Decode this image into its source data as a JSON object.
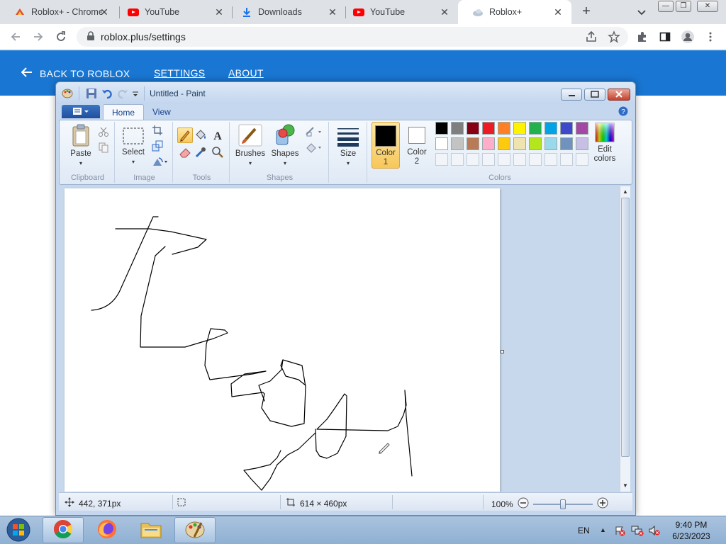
{
  "browser": {
    "tabs": [
      {
        "title": "Roblox+ - Chrome",
        "icon": "roblox-plus-icon"
      },
      {
        "title": "YouTube",
        "icon": "youtube-icon"
      },
      {
        "title": "Downloads",
        "icon": "download-icon"
      },
      {
        "title": "YouTube",
        "icon": "youtube-icon"
      },
      {
        "title": "Roblox+",
        "icon": "roblox-plus-icon"
      }
    ],
    "active_tab_index": 4,
    "url": "roblox.plus/settings"
  },
  "page": {
    "back_label": "BACK TO ROBLOX",
    "nav": [
      {
        "label": "SETTINGS"
      },
      {
        "label": "ABOUT"
      }
    ],
    "header_color": "#1976d2"
  },
  "paint": {
    "window_title": "Untitled - Paint",
    "tabs": [
      {
        "label": "Home"
      },
      {
        "label": "View"
      }
    ],
    "groups": {
      "clipboard": {
        "label": "Clipboard",
        "paste_label": "Paste"
      },
      "image": {
        "label": "Image",
        "select_label": "Select"
      },
      "tools": {
        "label": "Tools"
      },
      "shapes": {
        "label": "Shapes",
        "brushes_label": "Brushes",
        "shapes_label": "Shapes"
      },
      "size": {
        "label": "Size"
      },
      "colors": {
        "label": "Colors",
        "color1_label": "Color",
        "color1_num": "1",
        "color2_label": "Color",
        "color2_num": "2",
        "edit_label": "Edit",
        "edit_label2": "colors"
      }
    },
    "palette_row1": [
      "#000000",
      "#7f7f7f",
      "#880015",
      "#ed1c24",
      "#ff7f27",
      "#fff200",
      "#22b14c",
      "#00a2e8",
      "#3f48cc",
      "#a349a4"
    ],
    "palette_row2": [
      "#ffffff",
      "#c3c3c3",
      "#b97a57",
      "#ffaec9",
      "#ffc90e",
      "#efe4b0",
      "#b5e61d",
      "#99d9ea",
      "#7092be",
      "#c8bfe7"
    ],
    "status": {
      "cursor_pos": "442, 371px",
      "image_size": "614 × 460px",
      "zoom": "100%"
    }
  },
  "taskbar": {
    "language": "EN",
    "time": "9:40 PM",
    "date": "6/23/2023"
  }
}
